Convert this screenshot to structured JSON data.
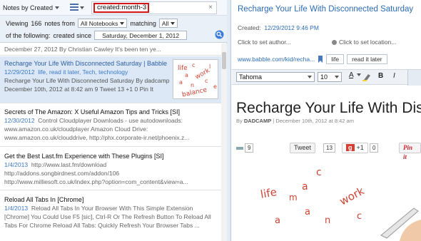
{
  "toolbar": {
    "sort_label": "Notes by Created",
    "search_query": "created:month-3",
    "clear_symbol": "×"
  },
  "filters": {
    "viewing_prefix": "Viewing",
    "note_count": "166",
    "notes_from": "notes from",
    "notebook": "All Notebooks",
    "matching": "matching",
    "match_mode": "All",
    "of_following": "of the following:",
    "criterion": "created since",
    "date": "Saturday, December 1, 2012"
  },
  "notes": [
    {
      "title": "",
      "date": "",
      "snippet": "December 27, 2012 By Christian Cawley It's been ten ye..."
    },
    {
      "title": "Recharge Your Life With Disconnected Saturday | Babble",
      "date": "12/29/2012",
      "snippet": "life, read it later, Tech, technology",
      "snippet2": "Recharge Your Life With Disconnected Saturday By dadcamp|",
      "snippet3": "December 10th, 2012 at 8:42 am 9 Tweet 13 +1 0 Pin It"
    },
    {
      "title": "Secrets of The Amazon: X Useful Amazon Tips and Tricks [SI]",
      "date": "12/30/2012",
      "snippet": "Control Cloudplayer Downloads - use autodownloads:",
      "snippet2": "www.amazon.co.uk/cloudplayer Amazon Cloud Drive:",
      "snippet3": "www.amazon.co.uk/clouddrive, http://phx.corporate-ir.net/phoenix.z..."
    },
    {
      "title": "Get the Best Last.fm Experience with These Plugins [SI]",
      "date": "1/4/2013",
      "snippet": "http://www.last.fm/download",
      "snippet2": "http://addons.songbirdnest.com/addon/106",
      "snippet3": "http://www.milliesoft.co.uk/index.php?option=com_content&view=a..."
    },
    {
      "title": "Reload All Tabs In [Chrome]",
      "date": "1/4/2013",
      "snippet": "Reload All Tabs In Your Browser With This Simple Extension",
      "snippet2": "[Chrome] You Could Use F5 [sic], Ctrl-R Or The Refresh Button To Reload All",
      "snippet3": "Tabs For Chrome Reload All Tabs: Quickly Refresh Your Browser Tabs ..."
    }
  ],
  "thumbnail_words": [
    "life",
    "c",
    "a",
    "work",
    "l",
    "a",
    "n",
    "c",
    "e",
    "balance"
  ],
  "note": {
    "title": "Recharge Your Life With Disconnected Saturday",
    "created_label": "Created:",
    "created_value": "12/29/2012 9:46 PM",
    "author_placeholder": "Click to set author...",
    "location_placeholder": "Click to set location...",
    "url": "www.babble.com/kid/recha...",
    "tags": [
      "life",
      "read it later"
    ]
  },
  "format_bar": {
    "font": "Tahoma",
    "size": "10",
    "color_letter": "A",
    "bold": "B",
    "italic": "I"
  },
  "article": {
    "heading": "Recharge Your Life With Dis",
    "by_prefix": "By",
    "author": "DADCAMP",
    "date": "| December 10th, 2012 at 8:42 am",
    "like_count": "9",
    "tweet_label": "Tweet",
    "tweet_count": "13",
    "gplus_label": "+1",
    "gplus_count": "0",
    "pin_label": "Pin it",
    "image_words": [
      "life",
      "c",
      "a",
      "m",
      "work",
      "a",
      "n",
      "c",
      "a"
    ]
  },
  "colors": {
    "accent_blue": "#2c6cb5",
    "search_highlight": "#d31515",
    "selection": "#dce8f6"
  }
}
